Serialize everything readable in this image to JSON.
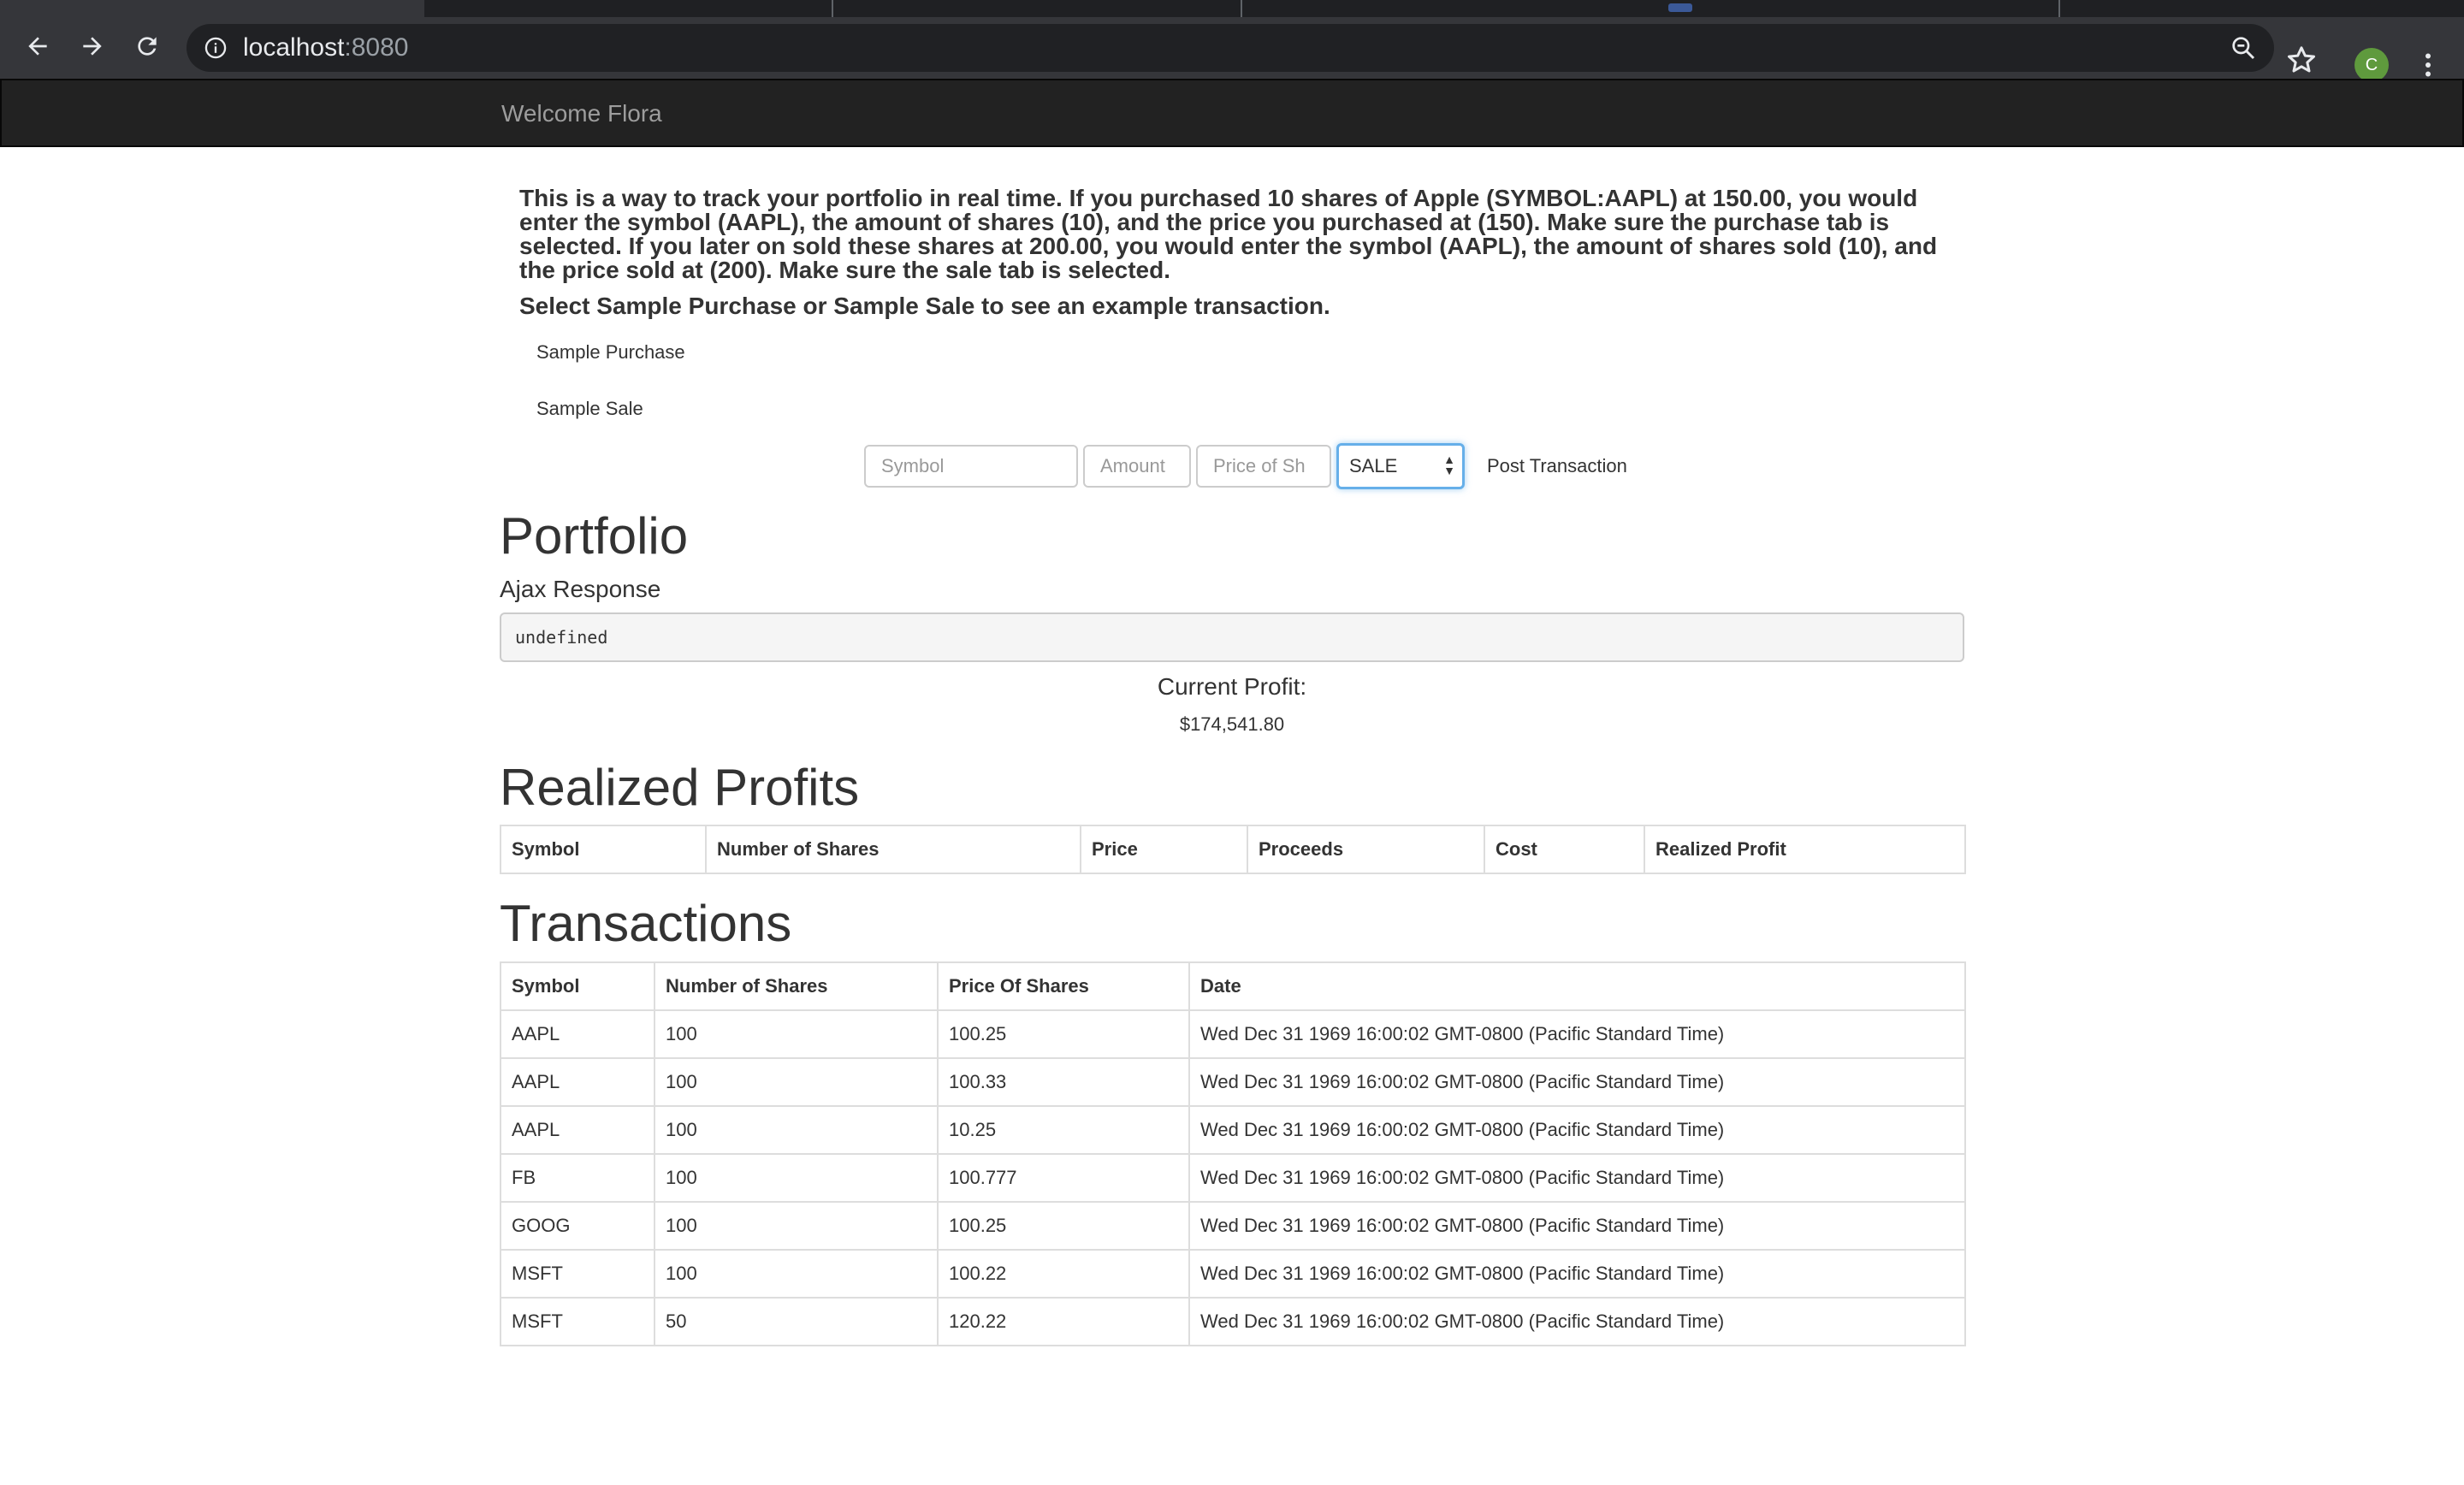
{
  "browser": {
    "url_host": "localhost",
    "url_port": ":8080",
    "profile_initial": "C"
  },
  "navbar": {
    "brand": "Welcome Flora"
  },
  "intro": {
    "paragraph": "This is a way to track your portfolio in real time. If you purchased 10 shares of Apple (SYMBOL:AAPL) at 150.00, you would enter the symbol (AAPL), the amount of shares (10), and the price you purchased at (150). Make sure the purchase tab is selected. If you later on sold these shares at 200.00, you would enter the symbol (AAPL), the amount of shares sold (10), and the price sold at (200). Make sure the sale tab is selected.",
    "instruction": "Select Sample Purchase or Sample Sale to see an example transaction."
  },
  "samples": {
    "purchase_label": "Sample Purchase",
    "sale_label": "Sample Sale"
  },
  "form": {
    "symbol_placeholder": "Symbol",
    "amount_placeholder": "Amount",
    "price_placeholder": "Price of Sh",
    "type_value": "SALE",
    "post_label": "Post Transaction"
  },
  "portfolio": {
    "title": "Portfolio",
    "ajax_label": "Ajax Response",
    "ajax_value": "undefined",
    "current_profit_label": "Current Profit:",
    "current_profit_value": "$174,541.80"
  },
  "realized": {
    "title": "Realized Profits",
    "headers": [
      "Symbol",
      "Number of Shares",
      "Price",
      "Proceeds",
      "Cost",
      "Realized Profit"
    ]
  },
  "transactions": {
    "title": "Transactions",
    "headers": [
      "Symbol",
      "Number of Shares",
      "Price Of Shares",
      "Date"
    ],
    "rows": [
      [
        "AAPL",
        "100",
        "100.25",
        "Wed Dec 31 1969 16:00:02 GMT-0800 (Pacific Standard Time)"
      ],
      [
        "AAPL",
        "100",
        "100.33",
        "Wed Dec 31 1969 16:00:02 GMT-0800 (Pacific Standard Time)"
      ],
      [
        "AAPL",
        "100",
        "10.25",
        "Wed Dec 31 1969 16:00:02 GMT-0800 (Pacific Standard Time)"
      ],
      [
        "FB",
        "100",
        "100.777",
        "Wed Dec 31 1969 16:00:02 GMT-0800 (Pacific Standard Time)"
      ],
      [
        "GOOG",
        "100",
        "100.25",
        "Wed Dec 31 1969 16:00:02 GMT-0800 (Pacific Standard Time)"
      ],
      [
        "MSFT",
        "100",
        "100.22",
        "Wed Dec 31 1969 16:00:02 GMT-0800 (Pacific Standard Time)"
      ],
      [
        "MSFT",
        "50",
        "120.22",
        "Wed Dec 31 1969 16:00:02 GMT-0800 (Pacific Standard Time)"
      ]
    ]
  }
}
